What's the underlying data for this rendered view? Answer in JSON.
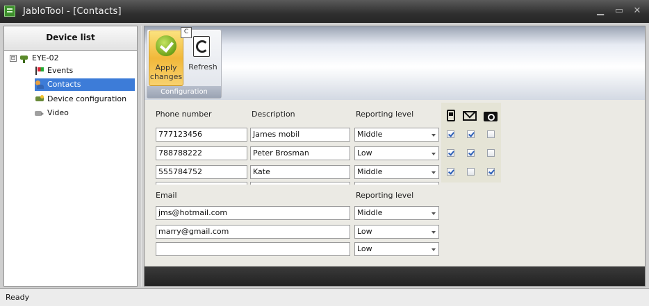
{
  "window": {
    "title": "JabloTool - [Contacts]"
  },
  "sidebar": {
    "header": "Device list",
    "root": {
      "label": "EYE-02",
      "expander": "⊟"
    },
    "items": [
      {
        "label": "Events",
        "icon": "events-icon"
      },
      {
        "label": "Contacts",
        "icon": "contacts-icon",
        "selected": true
      },
      {
        "label": "Device configuration",
        "icon": "device-configuration-icon"
      },
      {
        "label": "Video",
        "icon": "video-icon"
      }
    ]
  },
  "ribbon": {
    "group_label": "Configuration",
    "keytip": "C",
    "apply_label_line1": "Apply",
    "apply_label_line2": "changes",
    "refresh_label": "Refresh"
  },
  "phones": {
    "headers": {
      "phone": "Phone number",
      "description": "Description",
      "level": "Reporting level"
    },
    "flag_icons": [
      "phone-icon",
      "email-icon",
      "camera-icon"
    ],
    "rows": [
      {
        "phone": "777123456",
        "description": "James mobil",
        "level": "Middle",
        "flags": [
          true,
          true,
          false
        ]
      },
      {
        "phone": "788788222",
        "description": "Peter Brosman",
        "level": "Low",
        "flags": [
          true,
          true,
          false
        ]
      },
      {
        "phone": "555784752",
        "description": "Kate",
        "level": "Middle",
        "flags": [
          true,
          false,
          true
        ]
      }
    ]
  },
  "emails": {
    "headers": {
      "email": "Email",
      "level": "Reporting level"
    },
    "rows": [
      {
        "email": "jms@hotmail.com",
        "level": "Middle"
      },
      {
        "email": "marry@gmail.com",
        "level": "Low"
      },
      {
        "email": "",
        "level": "Low"
      }
    ]
  },
  "status": {
    "text": "Ready"
  },
  "colors": {
    "selection": "#3d7cd8",
    "titlebar": "#2f2f2f",
    "apply_button": "#f1b83a"
  }
}
